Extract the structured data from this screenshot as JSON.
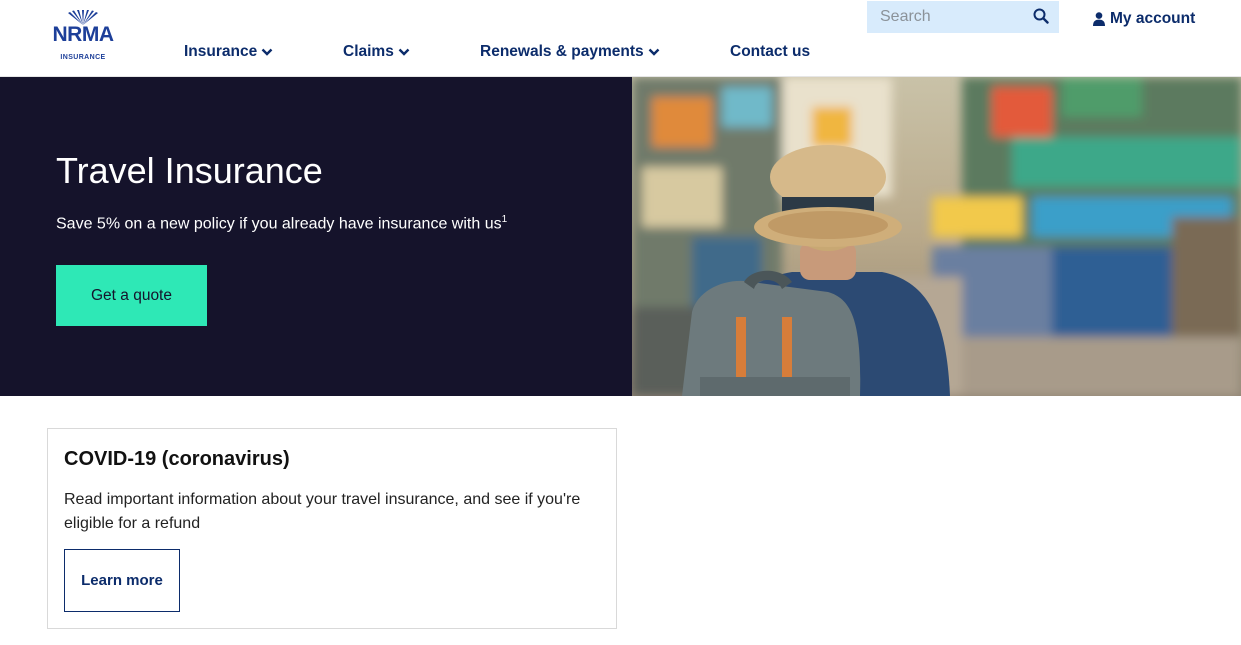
{
  "brand": {
    "logo_word": "NRMA",
    "logo_sub": "INSURANCE",
    "color": "#1d3f99"
  },
  "nav": {
    "items": [
      {
        "label": "Insurance",
        "has_dropdown": true
      },
      {
        "label": "Claims",
        "has_dropdown": true
      },
      {
        "label": "Renewals & payments",
        "has_dropdown": true
      },
      {
        "label": "Contact us",
        "has_dropdown": false
      }
    ]
  },
  "search": {
    "placeholder": "Search",
    "value": "",
    "icon": "search-icon"
  },
  "account": {
    "label": "My account",
    "icon": "person-icon"
  },
  "hero": {
    "title": "Travel Insurance",
    "subtitle": "Save 5% on a new policy if you already have insurance with us",
    "footnote": "1",
    "cta_label": "Get a quote",
    "cta_color": "#2ee8b6",
    "background": "#15132b"
  },
  "covid_card": {
    "title": "COVID-19 (coronavirus)",
    "text": "Read important information about your travel insurance, and see if you're eligible for a refund",
    "button_label": "Learn more"
  }
}
